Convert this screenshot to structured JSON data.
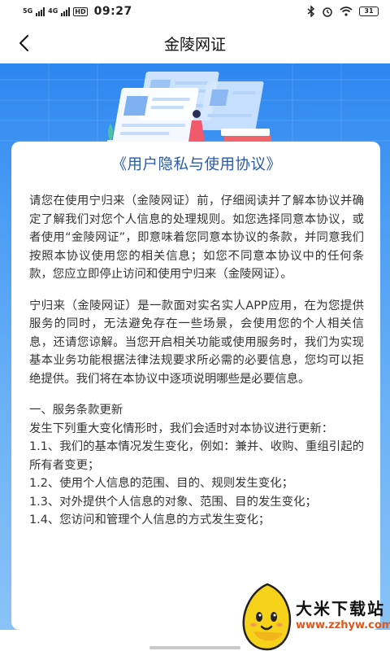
{
  "status_bar": {
    "net1": "5G",
    "net2": "4G",
    "hd": "HD",
    "time": "09:27",
    "battery": "31"
  },
  "nav": {
    "back_icon": "chevron-left-icon",
    "title": "金陵网证"
  },
  "card": {
    "title": "《用户隐私与使用协议》",
    "paragraphs": [
      "请您在使用宁归来（金陵网证）前，仔细阅读并了解本协议并确定了解我们对您个人信息的处理规则。如您选择同意本协议，或者使用“金陵网证”，即意味着您同意本协议的条款，并同意我们按照本协议使用您的相关信息；如您不同意本协议中的任何条款，您应立即停止访问和使用宁归来（金陵网证）。",
      "宁归来（金陵网证）是一款面对实名实人APP应用，在为您提供服务的同时，无法避免存在一些场景，会使用您的个人相关信息，还请您谅解。当您开启相关功能或使用服务时，我们为实现基本业务功能根据法律法规要求所必需的必要信息，您均可以拒绝提供。我们将在本协议中逐项说明哪些是必要信息。",
      "一、服务条款更新",
      "发生下列重大变化情形时，我们会适时对本协议进行更新：",
      "1.1、我们的基本情况发生变化，例如：兼并、收购、重组引起的所有者变更；",
      "1.2、使用个人信息的范围、目的、规则发生变化；",
      "1.3、对外提供个人信息的对象、范围、目的发生变化；",
      "1.4、您访问和管理个人信息的方式发生变化；"
    ]
  },
  "watermark": {
    "name": "大米下载站",
    "url": "www.zzhyw.com"
  },
  "colors": {
    "hero_top": "#2d87f0",
    "hero_bottom": "#8cc4f7",
    "title_blue": "#2a5aa8",
    "text": "#333333",
    "watermark_url": "#e0561a"
  }
}
